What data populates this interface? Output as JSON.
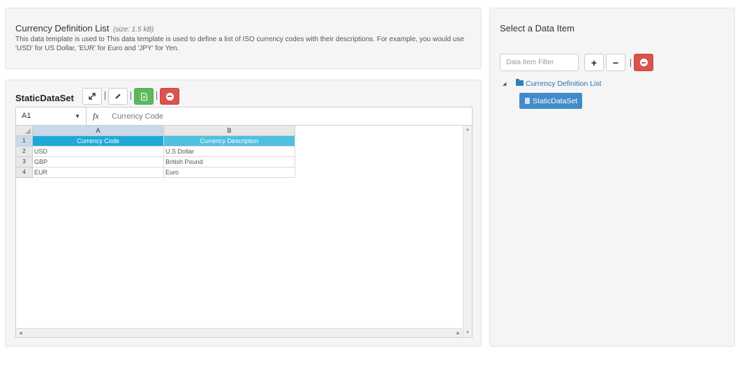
{
  "template": {
    "title": "Currency Definition List",
    "size": "(size: 1.5 kB)",
    "description": "This data template is used to This data template is used to define a list of ISO currency codes with their descriptions. For example, you would use 'USD' for US Dollar, 'EUR' for Euro and 'JPY' for Yen."
  },
  "dataset": {
    "title": "StaticDataSet",
    "toolbar_icons": [
      "expand-icon",
      "pencil-icon",
      "file-icon",
      "minus-circle-icon"
    ]
  },
  "sheet": {
    "cell_ref": "A1",
    "fx_label": "fx",
    "formula_value": "Currency Code",
    "columns": [
      "A",
      "B"
    ],
    "row_numbers": [
      "1",
      "2",
      "3",
      "4"
    ],
    "header_row": [
      "Currency Code",
      "Currency Description"
    ],
    "rows": [
      [
        "USD",
        "U.S Dollar"
      ],
      [
        "GBP",
        "British Pound"
      ],
      [
        "EUR",
        "Euro"
      ]
    ]
  },
  "side": {
    "title": "Select a Data Item",
    "filter_placeholder": "Data Item Filter",
    "add_label": "+",
    "remove_label": "−",
    "tree_root": "Currency Definition List",
    "tree_leaf": "StaticDataSet"
  },
  "colors": {
    "header_primary": "#20a8d8",
    "header_secondary": "#4fc0e0",
    "danger": "#d9534f",
    "success": "#5cb85c",
    "selected_item": "#428bca"
  }
}
